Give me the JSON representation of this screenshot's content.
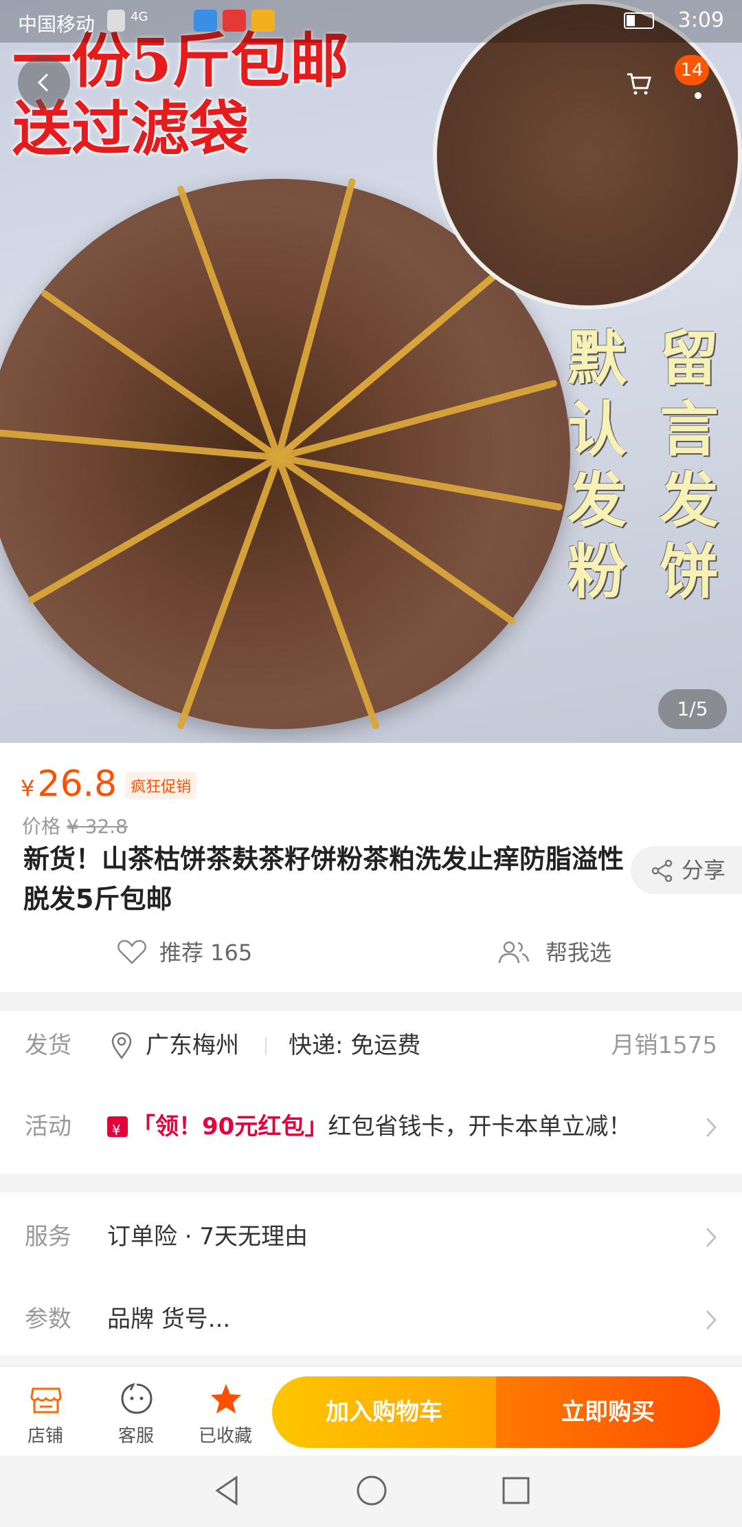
{
  "status_bar": {
    "carrier": "中国移动",
    "network": "4G",
    "time": "3:09"
  },
  "hero_image": {
    "overlay_text_top": [
      "一份5斤包邮",
      "送过滤袋"
    ],
    "overlay_text_right_col1": [
      "默",
      "认",
      "发",
      "粉"
    ],
    "overlay_text_right_col2": [
      "留",
      "言",
      "发",
      "饼"
    ],
    "pager": "1/5",
    "cart_badge": "14"
  },
  "product": {
    "currency_symbol": "¥",
    "price": "26.8",
    "promo_tag": "疯狂促销",
    "original_price_label": "价格",
    "original_price": "¥ 32.8",
    "title": "新货！山茶枯饼茶麸茶籽饼粉茶粕洗发止痒防脂溢性脱发5斤包邮",
    "share_label": "分享",
    "recommend_label": "推荐 165",
    "help_choose_label": "帮我选"
  },
  "shipping": {
    "label": "发货",
    "location": "广东梅州",
    "express": "快递: 免运费",
    "monthly_sales": "月销1575"
  },
  "activity": {
    "label": "活动",
    "highlight": "「领！90元红包」",
    "text": "红包省钱卡，开卡本单立减！"
  },
  "service": {
    "label": "服务",
    "value": "订单险 · 7天无理由"
  },
  "params": {
    "label": "参数",
    "value": "品牌 货号..."
  },
  "bottom_bar": {
    "store_label": "店铺",
    "service_label": "客服",
    "favorite_label": "已收藏",
    "add_to_cart": "加入购物车",
    "buy_now": "立即购买"
  },
  "colors": {
    "accent": "#ff5000",
    "cart_button": "#ffb300",
    "buy_button": "#ff5a00",
    "red_packet": "#e4003a"
  }
}
